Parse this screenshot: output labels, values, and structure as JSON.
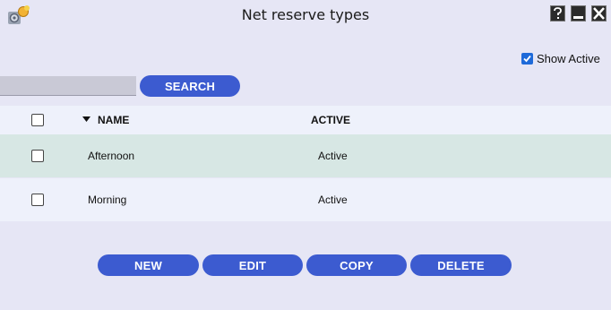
{
  "window": {
    "title": "Net reserve types",
    "app_icon": "app-settings-icon",
    "controls": {
      "help_icon": "help-icon",
      "minimize_icon": "minimize-icon",
      "close_icon": "close-icon"
    }
  },
  "filter": {
    "show_active_label": "Show Active",
    "show_active_checked": true
  },
  "search": {
    "placeholder": "",
    "value": "",
    "button_label": "SEARCH"
  },
  "table": {
    "columns": [
      {
        "label": "NAME",
        "sort": "descending-arrow"
      },
      {
        "label": "ACTIVE"
      }
    ],
    "rows": [
      {
        "name": "Afternoon",
        "active": "Active",
        "checked": false
      },
      {
        "name": "Morning",
        "active": "Active",
        "checked": false
      }
    ]
  },
  "actions": {
    "new_label": "NEW",
    "edit_label": "EDIT",
    "copy_label": "COPY",
    "delete_label": "DELETE"
  },
  "colors": {
    "accent": "#3c5bd0",
    "background": "#e6e6f5",
    "row_highlight": "#d7e7e4",
    "row_alt": "#eef1fb"
  }
}
